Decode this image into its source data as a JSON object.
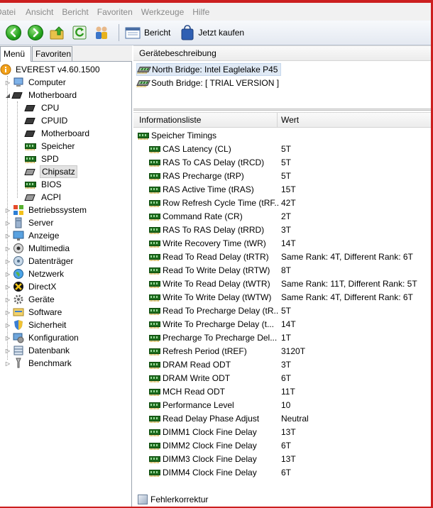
{
  "menubar": {
    "items": [
      "Datei",
      "Ansicht",
      "Bericht",
      "Favoriten",
      "Werkzeuge",
      "Hilfe"
    ]
  },
  "toolbar": {
    "report_label": "Bericht",
    "buy_label": "Jetzt kaufen"
  },
  "tabs": {
    "menu": "Menü",
    "favorites": "Favoriten"
  },
  "tree": {
    "root": "EVEREST v4.60.1500",
    "items": [
      "Computer",
      "Motherboard",
      "CPU",
      "CPUID",
      "Motherboard",
      "Speicher",
      "SPD",
      "Chipsatz",
      "BIOS",
      "ACPI",
      "Betriebssystem",
      "Server",
      "Anzeige",
      "Multimedia",
      "Datenträger",
      "Netzwerk",
      "DirectX",
      "Geräte",
      "Software",
      "Sicherheit",
      "Konfiguration",
      "Datenbank",
      "Benchmark"
    ]
  },
  "devices": {
    "header": "Gerätebeschreibung",
    "items": [
      "North Bridge: Intel Eaglelake P45",
      "South Bridge: [ TRIAL VERSION ]"
    ]
  },
  "info": {
    "col_name": "Informationsliste",
    "col_value": "Wert",
    "group": "Speicher Timings",
    "rows": [
      {
        "name": "CAS Latency (CL)",
        "value": "5T"
      },
      {
        "name": "RAS To CAS Delay (tRCD)",
        "value": "5T"
      },
      {
        "name": "RAS Precharge (tRP)",
        "value": "5T"
      },
      {
        "name": "RAS Active Time (tRAS)",
        "value": "15T"
      },
      {
        "name": "Row Refresh Cycle Time (tRF...",
        "value": "42T"
      },
      {
        "name": "Command Rate (CR)",
        "value": "2T"
      },
      {
        "name": "RAS To RAS Delay (tRRD)",
        "value": "3T"
      },
      {
        "name": "Write Recovery Time (tWR)",
        "value": "14T"
      },
      {
        "name": "Read To Read Delay (tRTR)",
        "value": "Same Rank: 4T, Different Rank: 6T"
      },
      {
        "name": "Read To Write Delay (tRTW)",
        "value": "8T"
      },
      {
        "name": "Write To Read Delay (tWTR)",
        "value": "Same Rank: 11T, Different Rank: 5T"
      },
      {
        "name": "Write To Write Delay (tWTW)",
        "value": "Same Rank: 4T, Different Rank: 6T"
      },
      {
        "name": "Read To Precharge Delay (tR...",
        "value": "5T"
      },
      {
        "name": "Write To Precharge Delay (t...",
        "value": "14T"
      },
      {
        "name": "Precharge To Precharge Del...",
        "value": "1T"
      },
      {
        "name": "Refresh Period (tREF)",
        "value": "3120T"
      },
      {
        "name": "DRAM Read ODT",
        "value": "3T"
      },
      {
        "name": "DRAM Write ODT",
        "value": "6T"
      },
      {
        "name": "MCH Read ODT",
        "value": "11T"
      },
      {
        "name": "Performance Level",
        "value": "10"
      },
      {
        "name": "Read Delay Phase Adjust",
        "value": "Neutral"
      },
      {
        "name": "DIMM1 Clock Fine Delay",
        "value": "13T"
      },
      {
        "name": "DIMM2 Clock Fine Delay",
        "value": "6T"
      },
      {
        "name": "DIMM3 Clock Fine Delay",
        "value": "13T"
      },
      {
        "name": "DIMM4 Clock Fine Delay",
        "value": "6T"
      }
    ],
    "group2": "Fehlerkorrektur"
  }
}
